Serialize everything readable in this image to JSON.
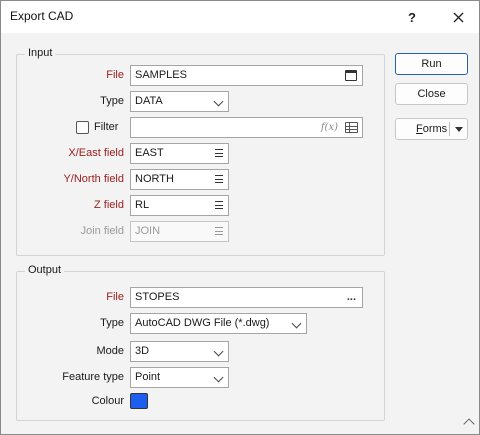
{
  "window": {
    "title": "Export CAD",
    "help": "?",
    "close": "✕"
  },
  "input_group": {
    "title": "Input",
    "file": {
      "label": "File",
      "value": "SAMPLES"
    },
    "type": {
      "label": "Type",
      "value": "DATA"
    },
    "filter": {
      "label": "Filter",
      "value": "",
      "checked": false,
      "fx": "f(x)"
    },
    "x_field": {
      "label": "X/East field",
      "value": "EAST"
    },
    "y_field": {
      "label": "Y/North field",
      "value": "NORTH"
    },
    "z_field": {
      "label": "Z field",
      "value": "RL"
    },
    "join_field": {
      "label": "Join field",
      "value": "JOIN"
    }
  },
  "output_group": {
    "title": "Output",
    "file": {
      "label": "File",
      "value": "STOPES",
      "browse": "..."
    },
    "type": {
      "label": "Type",
      "value": "AutoCAD DWG File (*.dwg)"
    },
    "mode": {
      "label": "Mode",
      "value": "3D"
    },
    "feature_type": {
      "label": "Feature type",
      "value": "Point"
    },
    "colour": {
      "label": "Colour",
      "value": "#1b5ef0"
    }
  },
  "buttons": {
    "run": "Run",
    "close": "Close",
    "forms": "Forms"
  }
}
